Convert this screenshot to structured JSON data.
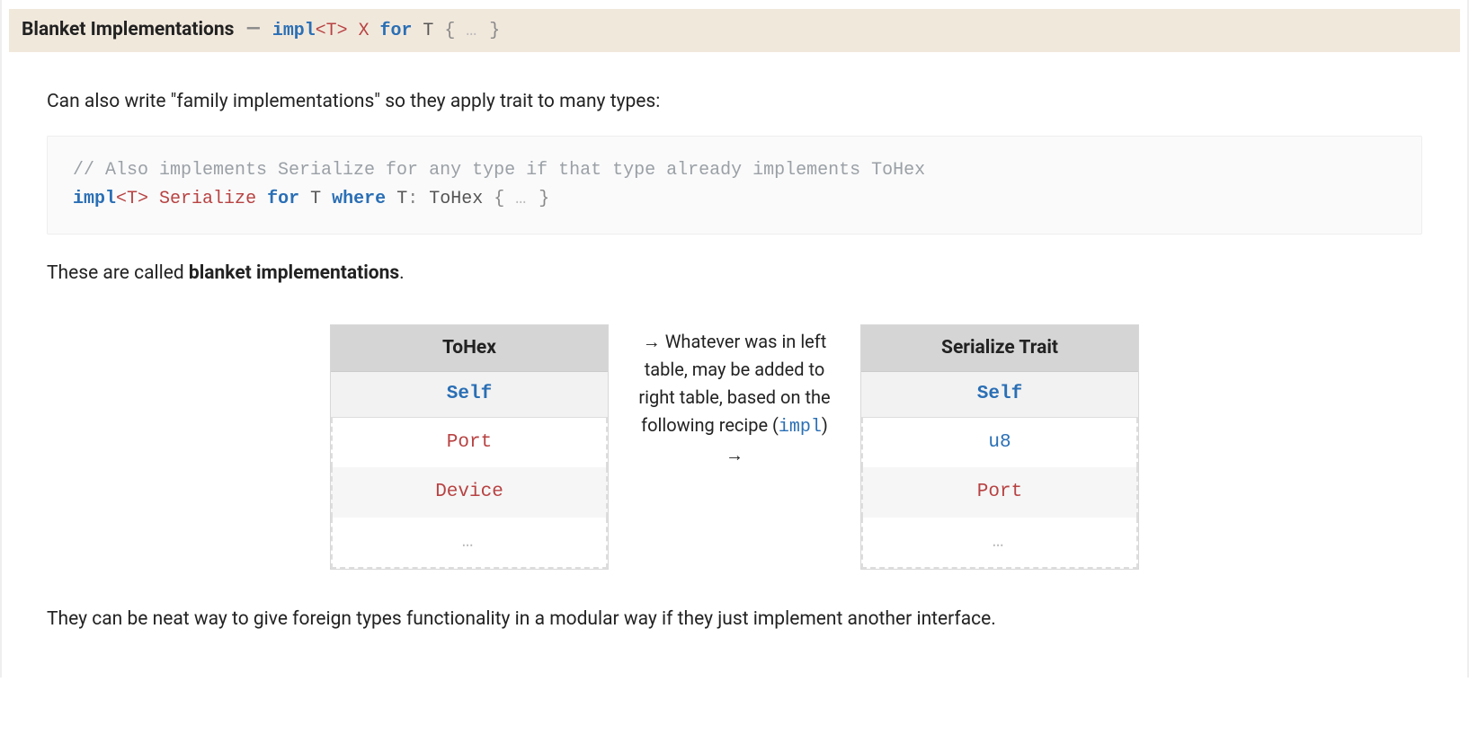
{
  "banner": {
    "title": "Blanket Implementations",
    "sep": "—",
    "code": {
      "tokens": [
        {
          "t": "impl",
          "c": "kw"
        },
        {
          "t": "<T>",
          "c": "type"
        },
        {
          "t": " ",
          "c": ""
        },
        {
          "t": "X",
          "c": "type"
        },
        {
          "t": " ",
          "c": ""
        },
        {
          "t": "for",
          "c": "kw"
        },
        {
          "t": " ",
          "c": ""
        },
        {
          "t": "T",
          "c": "ident"
        },
        {
          "t": " { ",
          "c": "punc"
        },
        {
          "t": "…",
          "c": "dots"
        },
        {
          "t": " }",
          "c": "punc"
        }
      ]
    }
  },
  "intro": "Can also write \"family implementations\" so they apply trait to many types:",
  "code_block": {
    "line1_comment": "// Also implements Serialize for any type if that type already implements ToHex",
    "line2": [
      {
        "t": "impl",
        "c": "kw"
      },
      {
        "t": "<T>",
        "c": "type"
      },
      {
        "t": " ",
        "c": ""
      },
      {
        "t": "Serialize",
        "c": "type"
      },
      {
        "t": " ",
        "c": ""
      },
      {
        "t": "for",
        "c": "kw"
      },
      {
        "t": " ",
        "c": ""
      },
      {
        "t": "T",
        "c": "ident"
      },
      {
        "t": " ",
        "c": ""
      },
      {
        "t": "where",
        "c": "kw"
      },
      {
        "t": " ",
        "c": ""
      },
      {
        "t": "T",
        "c": "ident"
      },
      {
        "t": ": ",
        "c": "punc"
      },
      {
        "t": "ToHex",
        "c": "ident"
      },
      {
        "t": " { ",
        "c": "punc"
      },
      {
        "t": "…",
        "c": "dots"
      },
      {
        "t": " }",
        "c": "punc"
      }
    ]
  },
  "after_code_pre": "These are called ",
  "after_code_strong": "blanket implementations",
  "after_code_post": ".",
  "tables": {
    "left": {
      "header": "ToHex",
      "sub": "Self",
      "rows": [
        "Port",
        "Device",
        "…"
      ]
    },
    "middle": {
      "arrow_l": "→",
      "text_a": "Whatever was in left table, may be added to right table, based on the following recipe (",
      "impl": "impl",
      "text_b": ")",
      "arrow_r": "→"
    },
    "right": {
      "header": "Serialize Trait",
      "sub": "Self",
      "rows": [
        "u8",
        "Port",
        "…"
      ]
    }
  },
  "closing": "They can be neat way to give foreign types functionality in a modular way if they just implement another interface."
}
